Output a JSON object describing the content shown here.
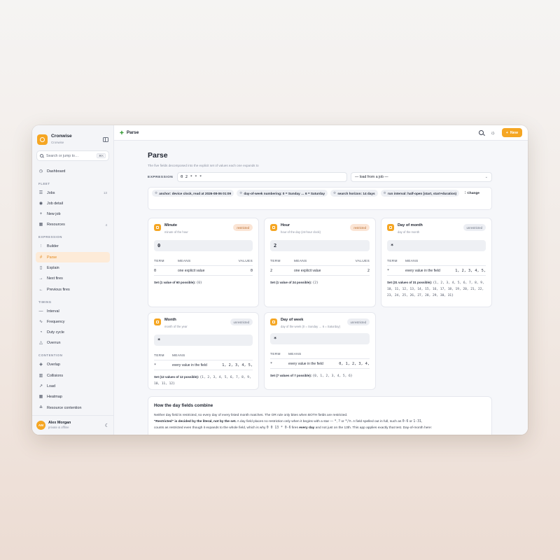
{
  "app": {
    "name": "Cronwise",
    "subtitle": "Cronwise"
  },
  "search": {
    "placeholder": "Search or jump to…",
    "shortcut": "⌘K"
  },
  "nav": {
    "dashboard": "Dashboard",
    "fleet_label": "FLEET",
    "fleet": [
      {
        "label": "Jobs",
        "count": "13",
        "icon": "list-icon"
      },
      {
        "label": "Job detail",
        "count": "",
        "icon": "eye-icon"
      },
      {
        "label": "New job",
        "count": "",
        "icon": "plus-icon"
      },
      {
        "label": "Resources",
        "count": "4",
        "icon": "grid-icon"
      }
    ],
    "expression_label": "EXPRESSION",
    "expression": [
      {
        "label": "Builder",
        "icon": "sliders-icon"
      },
      {
        "label": "Parse",
        "icon": "hash-icon",
        "active": true
      },
      {
        "label": "Explain",
        "icon": "book-icon"
      },
      {
        "label": "Next fires",
        "icon": "arrow-right-icon"
      },
      {
        "label": "Previous fires",
        "icon": "arrow-left-icon"
      }
    ],
    "timing_label": "TIMING",
    "timing": [
      {
        "label": "Interval",
        "icon": "minus-icon"
      },
      {
        "label": "Frequency",
        "icon": "activity-icon"
      },
      {
        "label": "Duty cycle",
        "icon": "gauge-icon"
      },
      {
        "label": "Overrun",
        "icon": "warning-icon"
      }
    ],
    "contention_label": "CONTENTION",
    "contention": [
      {
        "label": "Overlap",
        "icon": "layers-icon"
      },
      {
        "label": "Collisions",
        "icon": "bar-chart-icon"
      },
      {
        "label": "Load",
        "icon": "trend-icon"
      },
      {
        "label": "Heatmap",
        "icon": "grid-icon"
      },
      {
        "label": "Resource contention",
        "icon": "stack-icon"
      }
    ]
  },
  "user": {
    "initials": "AM",
    "name": "Alex Morgan",
    "status": "private & offline"
  },
  "topbar": {
    "title": "Parse",
    "new_label": "New"
  },
  "page": {
    "title": "Parse",
    "subtitle": "The five fields decomposed into the explicit set of values each one expands to",
    "expression_label": "EXPRESSION",
    "expression_value": "0 2 * * *",
    "job_select": "— load from a job —",
    "chips": [
      "anchor: device clock, read at 2026-08-06 01:09",
      "day-of-week numbering: 0 = Sunday … 6 = Saturday",
      "search horizon: 14 days",
      "run interval: half-open [start, start+duration)"
    ],
    "change_label": "Change"
  },
  "table_headers": {
    "term": "TERM",
    "means": "MEANS",
    "values": "VALUES"
  },
  "fields": [
    {
      "name": "Minute",
      "desc": "minute of the hour",
      "badge": "restricted",
      "value": "0",
      "term": "0",
      "means": "one explicit value",
      "values": "0",
      "set_label": "Set (1 value of 60 possible):",
      "set": "{0}"
    },
    {
      "name": "Hour",
      "desc": "hour of the day (24-hour clock)",
      "badge": "restricted",
      "value": "2",
      "term": "2",
      "means": "one explicit value",
      "values": "2",
      "set_label": "Set (1 value of 24 possible):",
      "set": "{2}"
    },
    {
      "name": "Day of month",
      "desc": "day of the month",
      "badge": "unrestricted",
      "value": "*",
      "term": "*",
      "means": "every value in the field",
      "values": "1, 2, 3, 4, 5,",
      "set_label": "Set (31 values of 31 possible):",
      "set": "{1, 2, 3, 4, 5, 6, 7, 8, 9, 10, 11, 12, 13, 14, 15, 16, 17, 18, 19, 20, 21, 22, 23, 24, 25, 26, 27, 28, 29, 30, 31}"
    },
    {
      "name": "Month",
      "desc": "month of the year",
      "badge": "unrestricted",
      "value": "*",
      "term": "*",
      "means": "every value in the field",
      "values": "1, 2, 3, 4, 5,",
      "set_label": "Set (12 values of 12 possible):",
      "set": "{1, 2, 3, 4, 5, 6, 7, 8, 9, 10, 11, 12}"
    },
    {
      "name": "Day of week",
      "desc": "day of the week (0 = Sunday … 6 = Saturday)",
      "badge": "unrestricted",
      "value": "*",
      "term": "*",
      "means": "every value in the field",
      "values": "0, 1, 2, 3, 4,",
      "set_label": "Set (7 values of 7 possible):",
      "set": "{0, 1, 2, 3, 4, 5, 6}"
    }
  ],
  "how": {
    "title": "How the day fields combine",
    "line1": "Neither day field is restricted, so every day of every listed month matches. The OR rule only bites when BOTH fields are restricted.",
    "line2_bold": "\"Restricted\" is decided by the literal, not by the set.",
    "line2_a": " A day field places no restriction only when it begins with a star — ",
    "line2_c1": "*",
    "line2_b": ", ",
    "line2_c2": "?",
    "line2_c": " or ",
    "line2_c3": "*/n",
    "line2_d": ". A field spelled out in full, such as ",
    "line2_c4": "0-6",
    "line2_e": " or ",
    "line2_c5": "1-31",
    "line2_f": ",",
    "line3_a": "counts as restricted even though it expands to the whole field, which is why ",
    "line3_code": "0 0 13 * 0-6",
    "line3_b": " fires ",
    "line3_bold": "every day",
    "line3_c": " and not just on the 13th. This app applies exactly that test. Day-of-month here:"
  }
}
